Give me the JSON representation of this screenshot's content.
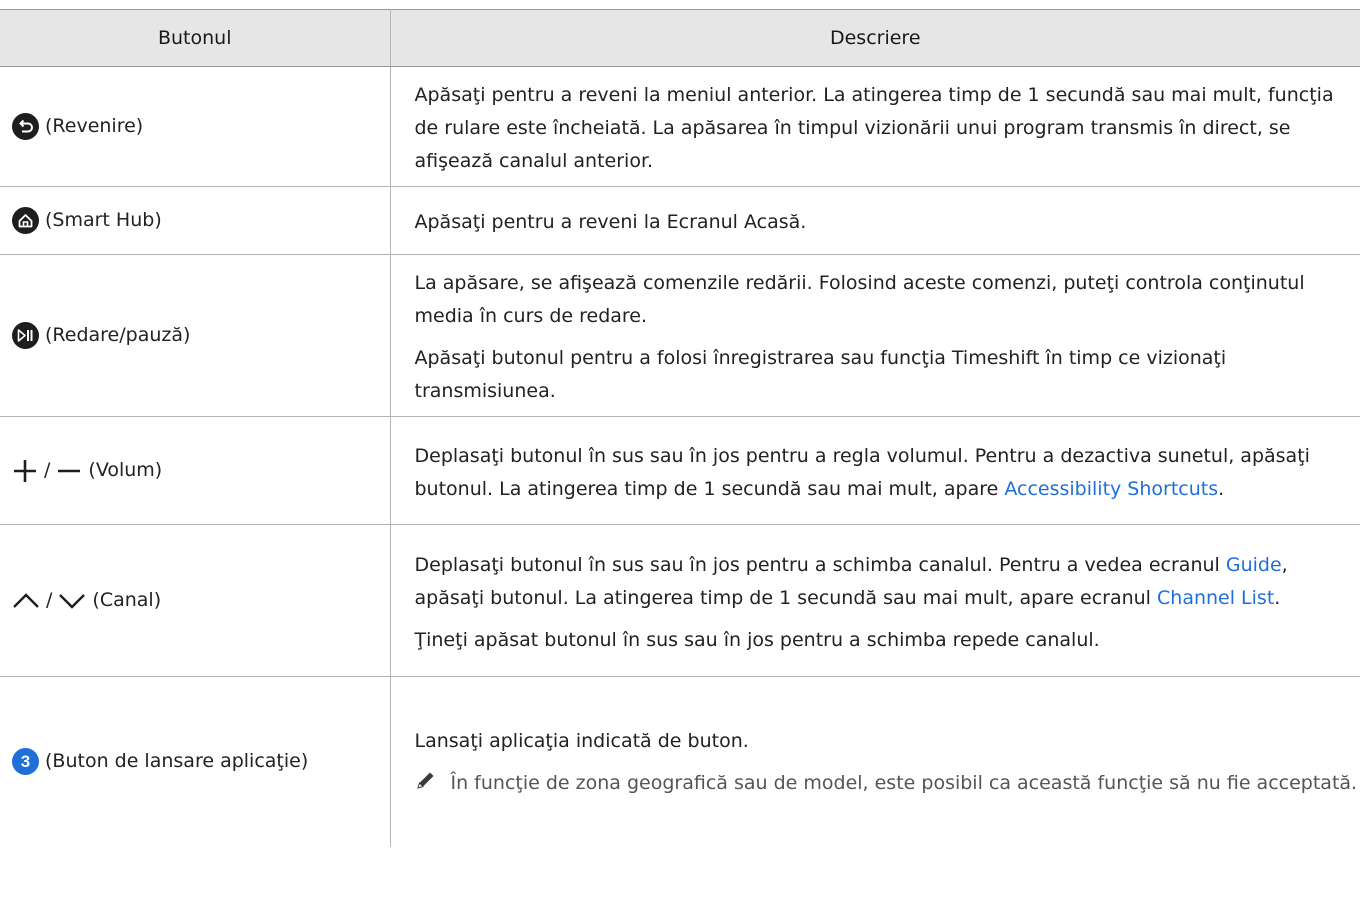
{
  "table": {
    "header": {
      "col_button": "Butonul",
      "col_description": "Descriere"
    },
    "rows": [
      {
        "button_label": "(Revenire)",
        "icon": "return-icon",
        "desc": "Apăsaţi pentru a reveni la meniul anterior. La atingerea timp de 1 secundă sau mai mult, funcţia de rulare este încheiată. La apăsarea în timpul vizionării unui program transmis în direct, se afişează canalul anterior."
      },
      {
        "button_label": "(Smart Hub)",
        "icon": "home-icon",
        "desc": "Apăsaţi pentru a reveni la Ecranul Acasă."
      },
      {
        "button_label": "(Redare/pauză)",
        "icon": "play-pause-icon",
        "desc_1": "La apăsare, se afişează comenzile redării. Folosind aceste comenzi, puteţi controla conţinutul media în curs de redare.",
        "desc_2": "Apăsaţi butonul pentru a folosi înregistrarea sau funcţia Timeshift în timp ce vizionaţi transmisiunea."
      },
      {
        "button_label": "(Volum)",
        "icon": "volume-plus-minus-icon",
        "sep": "/",
        "desc_a": "Deplasaţi butonul în sus sau în jos pentru a regla volumul. Pentru a dezactiva sunetul, apăsaţi butonul. La atingerea timp de 1 secundă sau mai mult, apare ",
        "link": "Accessibility Shortcuts",
        "desc_b": "."
      },
      {
        "button_label": "(Canal)",
        "icon": "channel-up-down-icon",
        "sep": "/",
        "desc_a": "Deplasaţi butonul în sus sau în jos pentru a schimba canalul. Pentru a vedea ecranul ",
        "link_1": "Guide",
        "desc_b": ", apăsaţi butonul. La atingerea timp de 1 secundă sau mai mult, apare ecranul ",
        "link_2": "Channel List",
        "desc_c": ".",
        "desc_2": "Ţineţi apăsat butonul în sus sau în jos pentru a schimba repede canalul."
      },
      {
        "button_label": "(Buton de lansare aplicaţie)",
        "icon": "number-3-icon",
        "icon_text": "3",
        "desc": "Lansaţi aplicaţia indicată de buton.",
        "note": "În funcţie de zona geografică sau de model, este posibil ca această funcţie să nu fie acceptată."
      }
    ]
  },
  "colors": {
    "header_bg": "#e6e6e6",
    "link": "#1f6fd8",
    "icon_dark": "#1e1e1e"
  }
}
